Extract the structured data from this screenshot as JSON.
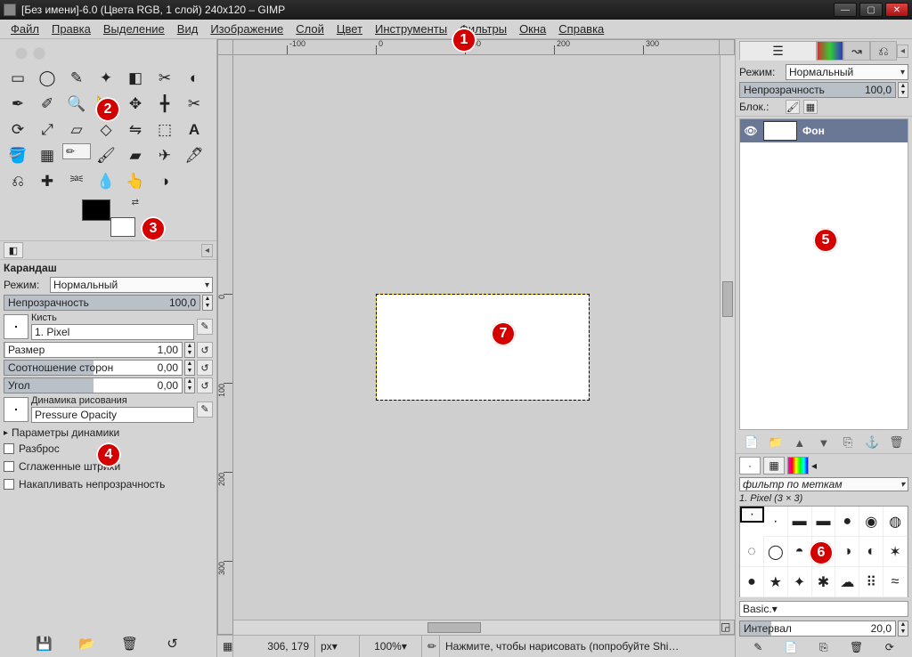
{
  "title": "[Без имени]-6.0 (Цвета RGB, 1 слой) 240x120 – GIMP",
  "menu": {
    "file": "Файл",
    "edit": "Правка",
    "select": "Выделение",
    "view": "Вид",
    "image": "Изображение",
    "layer": "Слой",
    "colors": "Цвет",
    "tools": "Инструменты",
    "filters": "Фильтры",
    "windows": "Окна",
    "help": "Справка"
  },
  "ruler_major_ticks": [
    "-100",
    "0",
    "100",
    "200",
    "300"
  ],
  "ruler_v_ticks": [
    "0",
    "100",
    "200",
    "300"
  ],
  "tool_options": {
    "title": "Карандаш",
    "mode_label": "Режим:",
    "mode_value": "Нормальный",
    "opacity_label": "Непрозрачность",
    "opacity_value": "100,0",
    "brush_label": "Кисть",
    "brush_name": "1. Pixel",
    "size_label": "Размер",
    "size_value": "1,00",
    "aspect_label": "Соотношение сторон",
    "aspect_value": "0,00",
    "angle_label": "Угол",
    "angle_value": "0,00",
    "dynamics_label": "Динамика рисования",
    "dynamics_value": "Pressure Opacity",
    "dyn_params": "Параметры динамики",
    "scatter": "Разброс",
    "smooth": "Сглаженные штрихи",
    "incr": "Накапливать непрозрачность"
  },
  "right": {
    "mode_label": "Режим:",
    "mode_value": "Нормальный",
    "opacity_label": "Непрозрачность",
    "opacity_value": "100,0",
    "lock_label": "Блок.:",
    "layer_name": "Фон",
    "brush_filter": "фильтр по меткам",
    "brush_name": "1. Pixel (3 × 3)",
    "preset": "Basic.",
    "spacing_label": "Интервал",
    "spacing_value": "20,0"
  },
  "status": {
    "coords": "306, 179",
    "unit": "px",
    "zoom": "100%",
    "hint": "Нажмите, чтобы нарисовать (попробуйте Shi…"
  },
  "markers": {
    "1": "1",
    "2": "2",
    "3": "3",
    "4": "4",
    "5": "5",
    "6": "6",
    "7": "7"
  }
}
